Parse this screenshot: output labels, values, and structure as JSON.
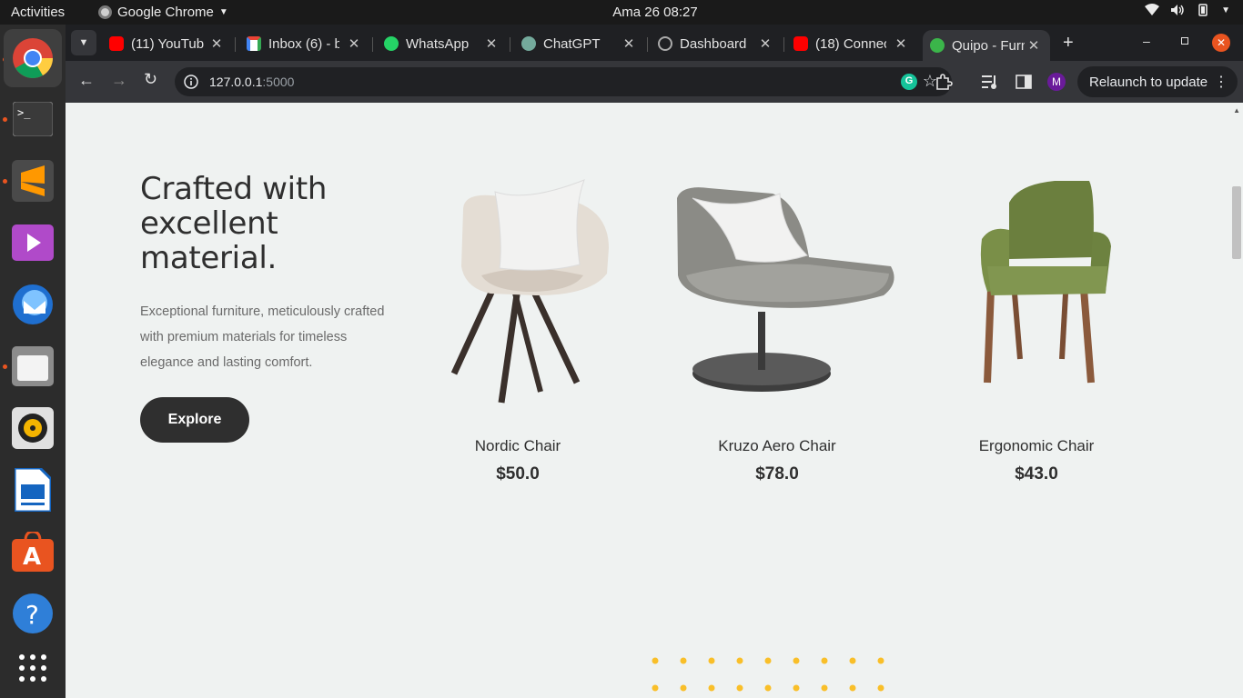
{
  "topbar": {
    "activities": "Activities",
    "app_name": "Google Chrome",
    "clock": "Ama 26  08:27"
  },
  "tabs": [
    {
      "title": "(11) YouTube",
      "favicon": "youtube-icon",
      "color": "#ff0000"
    },
    {
      "title": "Inbox (6) - b",
      "favicon": "gmail-icon",
      "color": "#ea4335"
    },
    {
      "title": "WhatsApp",
      "favicon": "whatsapp-icon",
      "color": "#25d366"
    },
    {
      "title": "ChatGPT",
      "favicon": "chatgpt-icon",
      "color": "#74aa9c"
    },
    {
      "title": "Dashboard",
      "favicon": "dashboard-icon",
      "color": "#222222"
    },
    {
      "title": "(18) Connec",
      "favicon": "youtube-icon",
      "color": "#ff0000"
    },
    {
      "title": "Quipo - Furn",
      "favicon": "quipo-icon",
      "color": "#3bb54a"
    }
  ],
  "toolbar": {
    "url_host": "127.0.0.1",
    "url_port": ":5000",
    "relaunch_label": "Relaunch to update",
    "profile_initial": "M"
  },
  "hero": {
    "headline": "Crafted with excellent material.",
    "description": "Exceptional furniture, meticulously crafted with premium materials for timeless elegance and lasting comfort.",
    "cta_label": "Explore"
  },
  "products": [
    {
      "name": "Nordic Chair",
      "price": "$50.0"
    },
    {
      "name": "Kruzo Aero Chair",
      "price": "$78.0"
    },
    {
      "name": "Ergonomic Chair",
      "price": "$43.0"
    }
  ],
  "colors": {
    "page_bg": "#eff2f1",
    "text_dark": "#2f2f2f",
    "accent_dots": "#f9bf29"
  }
}
